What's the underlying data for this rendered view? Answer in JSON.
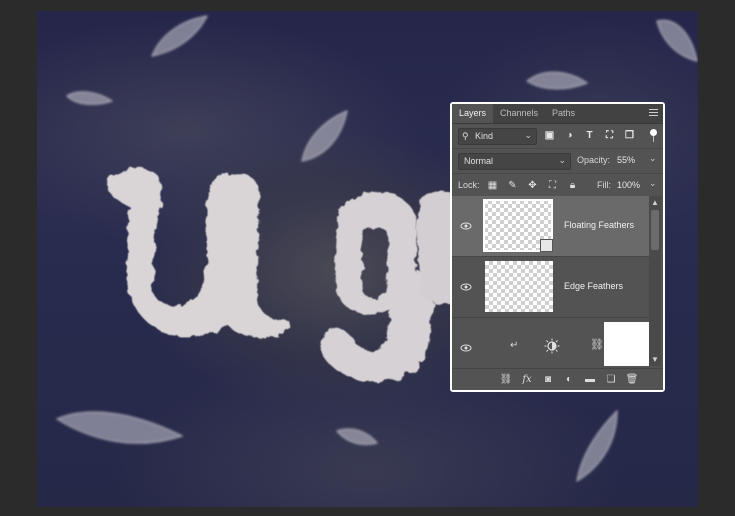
{
  "panel": {
    "tabs": [
      {
        "label": "Layers"
      },
      {
        "label": "Channels"
      },
      {
        "label": "Paths"
      }
    ],
    "filter": {
      "kind_label": "Kind"
    },
    "blend_mode": "Normal",
    "opacity_label": "Opacity:",
    "opacity_value": "55%",
    "lock_label": "Lock:",
    "fill_label": "Fill:",
    "fill_value": "100%",
    "layers": [
      {
        "name": "Floating Feathers",
        "selected": true,
        "visible": true
      },
      {
        "name": "Edge Feathers",
        "selected": false,
        "visible": true
      },
      {
        "name": "",
        "type": "adjustment",
        "visible": true
      }
    ]
  }
}
